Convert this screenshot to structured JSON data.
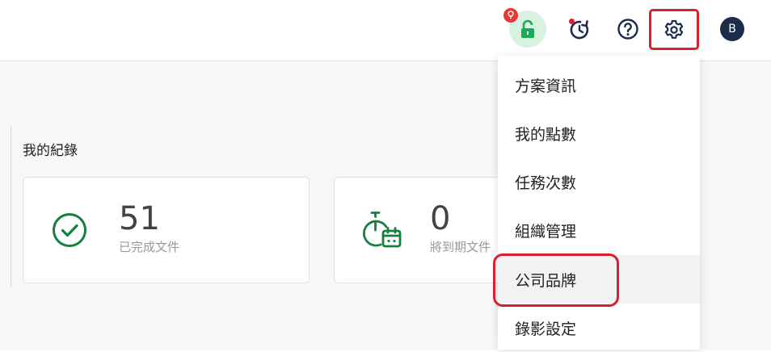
{
  "header": {
    "avatar_initial": "B",
    "icons": [
      "lock-icon",
      "history-icon",
      "help-icon",
      "gear-icon"
    ],
    "colors": {
      "lock_green": "#1aaa55",
      "badge_red": "#e53935",
      "highlight_red": "#d7212b",
      "icon_navy": "#1c2c4c"
    }
  },
  "main": {
    "section_title": "我的紀錄",
    "cards": [
      {
        "value": "51",
        "label": "已完成文件",
        "icon": "check-circle-icon"
      },
      {
        "value": "0",
        "label": "將到期文件",
        "icon": "stopwatch-calendar-icon"
      }
    ],
    "accent_color": "#15803d"
  },
  "settings_menu": {
    "items": [
      {
        "label": "方案資訊"
      },
      {
        "label": "我的點數"
      },
      {
        "label": "任務次數"
      },
      {
        "label": "組織管理"
      },
      {
        "label": "公司品牌"
      },
      {
        "label": "錄影設定"
      }
    ],
    "hovered_item": "公司品牌"
  }
}
